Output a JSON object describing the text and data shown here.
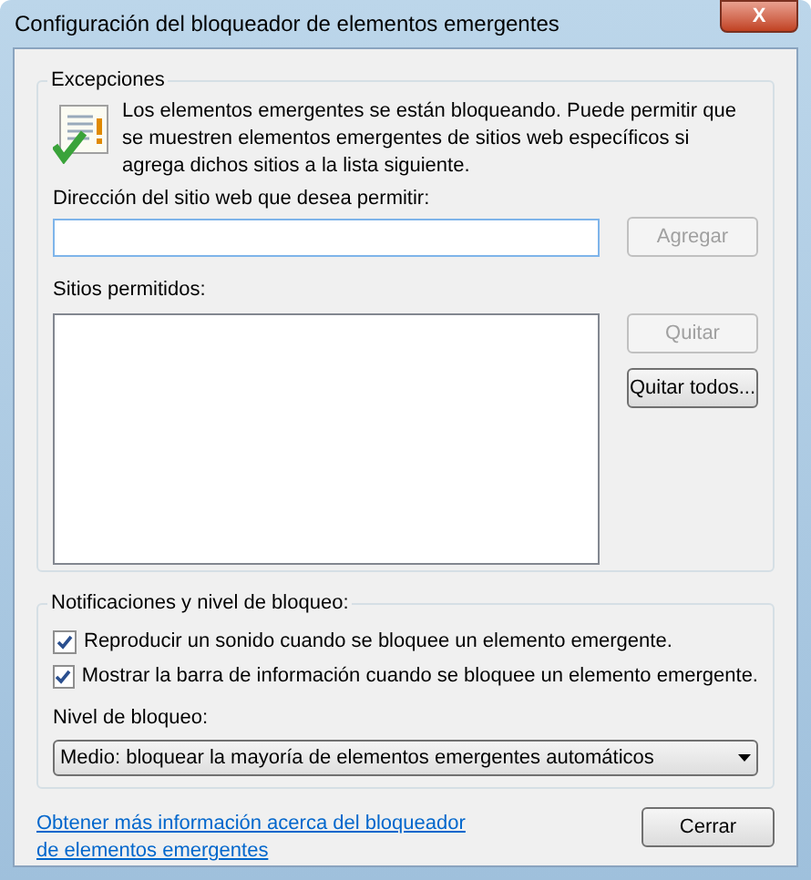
{
  "window": {
    "title": "Configuración del bloqueador de elementos emergentes",
    "close_label": "X"
  },
  "exceptions": {
    "title": "Excepciones",
    "message": "Los elementos emergentes se están bloqueando. Puede permitir que se muestren elementos emergentes de sitios web específicos si agrega dichos sitios a la lista siguiente.",
    "address_label": "Dirección del sitio web que desea permitir:",
    "address_focused": true,
    "add_button": {
      "label": "Agregar",
      "disabled": true
    },
    "allowed_label": "Sitios permitidos:",
    "buttons": [
      {
        "label": "Quitar",
        "disabled": true
      },
      {
        "label": "Quitar todos...",
        "disabled": false
      }
    ]
  },
  "notifications": {
    "title": "Notificaciones y nivel de bloqueo:",
    "options": [
      {
        "label": "Reproducir un sonido cuando se bloquee un elemento emergente.",
        "checked": true
      },
      {
        "label": "Mostrar la barra de información cuando se bloquee un elemento emergente.",
        "checked": true
      }
    ],
    "level_label": "Nivel de bloqueo:",
    "level_value": "Medio: bloquear la mayoría de elementos emergentes automáticos"
  },
  "help_link": "Obtener más información acerca del bloqueador de elementos emergentes",
  "close_button": "Cerrar"
}
